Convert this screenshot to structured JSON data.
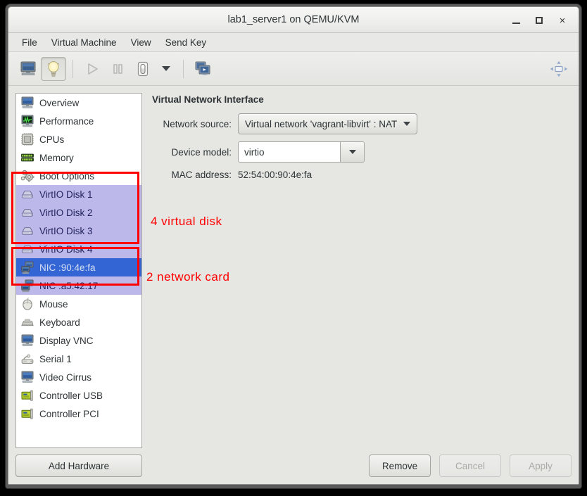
{
  "window": {
    "title": "lab1_server1 on QEMU/KVM",
    "controls": {
      "minimize": "minimize-icon",
      "maximize": "maximize-icon",
      "close": "×"
    }
  },
  "menubar": {
    "items": [
      {
        "label": "File"
      },
      {
        "label": "Virtual Machine"
      },
      {
        "label": "View"
      },
      {
        "label": "Send Key"
      }
    ]
  },
  "toolbar": {
    "buttons": [
      {
        "name": "show-console-view",
        "icon": "monitor-icon",
        "pressed": false,
        "enabled": true
      },
      {
        "name": "show-details-view",
        "icon": "lightbulb-icon",
        "pressed": true,
        "enabled": true
      },
      {
        "name": "run-vm",
        "icon": "play-icon",
        "pressed": false,
        "enabled": false
      },
      {
        "name": "pause-vm",
        "icon": "pause-icon",
        "pressed": false,
        "enabled": false
      },
      {
        "name": "shutdown-vm",
        "icon": "power-icon",
        "pressed": false,
        "enabled": true
      },
      {
        "name": "shutdown-options",
        "icon": "chevron-down-icon",
        "pressed": false,
        "enabled": true
      },
      {
        "name": "manage-snapshots",
        "icon": "snapshots-icon",
        "pressed": false,
        "enabled": true
      }
    ],
    "right_button": {
      "name": "fullscreen-toggle",
      "icon": "fullscreen-icon"
    }
  },
  "sidebar": {
    "items": [
      {
        "label": "Overview",
        "icon": "monitor-icon",
        "state": "normal"
      },
      {
        "label": "Performance",
        "icon": "graph-icon",
        "state": "normal"
      },
      {
        "label": "CPUs",
        "icon": "cpu-icon",
        "state": "normal"
      },
      {
        "label": "Memory",
        "icon": "memory-icon",
        "state": "normal"
      },
      {
        "label": "Boot Options",
        "icon": "gears-icon",
        "state": "normal"
      },
      {
        "label": "VirtIO Disk 1",
        "icon": "disk-icon",
        "state": "highlight"
      },
      {
        "label": "VirtIO Disk 2",
        "icon": "disk-icon",
        "state": "highlight"
      },
      {
        "label": "VirtIO Disk 3",
        "icon": "disk-icon",
        "state": "highlight"
      },
      {
        "label": "VirtIO Disk 4",
        "icon": "disk-icon",
        "state": "highlight"
      },
      {
        "label": "NIC :90:4e:fa",
        "icon": "nic-icon",
        "state": "selected"
      },
      {
        "label": "NIC :a5:42:17",
        "icon": "nic-icon",
        "state": "highlight"
      },
      {
        "label": "Mouse",
        "icon": "mouse-icon",
        "state": "normal"
      },
      {
        "label": "Keyboard",
        "icon": "keyboard-icon",
        "state": "normal"
      },
      {
        "label": "Display VNC",
        "icon": "monitor-icon",
        "state": "normal"
      },
      {
        "label": "Serial 1",
        "icon": "serial-icon",
        "state": "normal"
      },
      {
        "label": "Video Cirrus",
        "icon": "monitor-icon",
        "state": "normal"
      },
      {
        "label": "Controller USB",
        "icon": "pci-card-icon",
        "state": "normal"
      },
      {
        "label": "Controller PCI",
        "icon": "pci-card-icon",
        "state": "normal"
      }
    ],
    "add_hardware_label": "Add Hardware"
  },
  "detail": {
    "title": "Virtual Network Interface",
    "network_source": {
      "label": "Network source:",
      "value": "Virtual network 'vagrant-libvirt' : NAT"
    },
    "device_model": {
      "label": "Device model:",
      "value": "virtio"
    },
    "mac_address": {
      "label": "MAC address:",
      "value": "52:54:00:90:4e:fa"
    }
  },
  "annotations": {
    "color": "#fe0000",
    "disks_note": "4 virtual disk",
    "nics_note": "2 network card"
  },
  "footer": {
    "remove_label": "Remove",
    "cancel_label": "Cancel",
    "apply_label": "Apply",
    "cancel_enabled": false,
    "apply_enabled": false
  }
}
